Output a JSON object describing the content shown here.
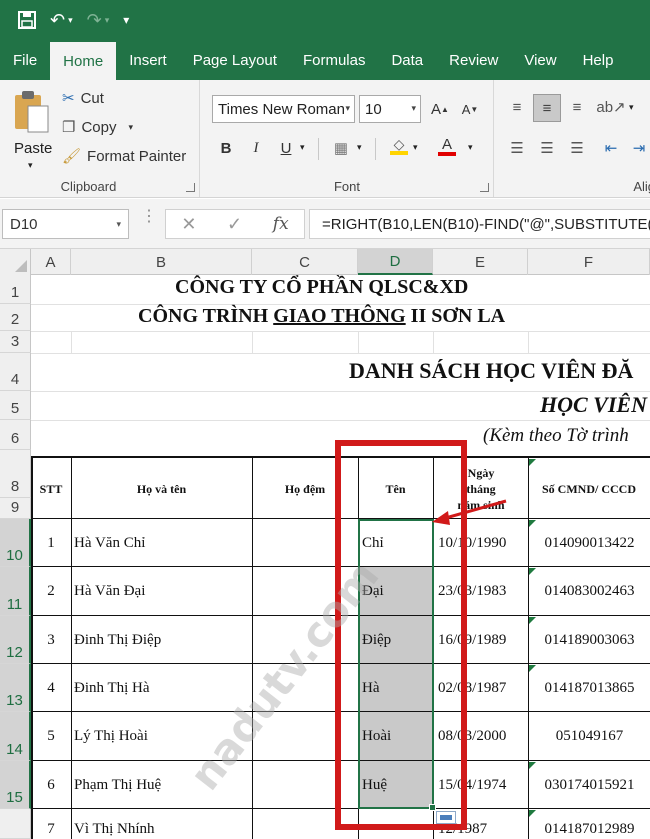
{
  "qat": {
    "save": "save-icon",
    "undo": "undo-icon",
    "redo": "redo-icon",
    "customize": "customize-icon"
  },
  "tabs": [
    "File",
    "Home",
    "Insert",
    "Page Layout",
    "Formulas",
    "Data",
    "Review",
    "View",
    "Help"
  ],
  "active_tab": "Home",
  "clipboard": {
    "paste": "Paste",
    "cut": "Cut",
    "copy": "Copy",
    "format_painter": "Format Painter",
    "label": "Clipboard"
  },
  "font": {
    "name": "Times New Roman",
    "size": "10",
    "bold": "B",
    "italic": "I",
    "underline": "U",
    "label": "Font",
    "font_color": "#e00000",
    "fill_color": "#ffd400"
  },
  "alignment": {
    "label": "Alig"
  },
  "formula_bar": {
    "name_box": "D10",
    "formula": "=RIGHT(B10,LEN(B10)-FIND(\"@\",SUBSTITUTE(B"
  },
  "columns": [
    "A",
    "B",
    "C",
    "D",
    "E",
    "F"
  ],
  "rows": [
    "1",
    "2",
    "3",
    "4",
    "5",
    "6",
    "8",
    "9",
    "10",
    "11",
    "12",
    "13",
    "14",
    "15"
  ],
  "sheet": {
    "title_line1": "CÔNG TY CỔ PHẦN QLSC&XD",
    "title_line2_pre": "CÔNG TRÌNH ",
    "title_line2_ul": "GIAO THÔNG",
    "title_line2_post": " II SƠN LA",
    "list_title": "DANH SÁCH HỌC VIÊN ĐĂ",
    "sub_title": "HỌC VIÊN",
    "note": "(Kèm theo Tờ trình",
    "headers": {
      "stt": "STT",
      "ho_ten": "Họ và tên",
      "ho_dem": "Họ đệm",
      "ten": "Tên",
      "ngay_sinh": "Ngày tháng năm sinh",
      "cmnd": "Số CMND/ CCCD"
    },
    "records": [
      {
        "stt": "1",
        "name": "Hà Văn Chỉ",
        "ten": "Chỉ",
        "dob": "10/10/1990",
        "id": "014090013422"
      },
      {
        "stt": "2",
        "name": "Hà Văn Đại",
        "ten": "Đại",
        "dob": "23/03/1983",
        "id": "014083002463"
      },
      {
        "stt": "3",
        "name": "Đinh Thị Điệp",
        "ten": "Điệp",
        "dob": "16/09/1989",
        "id": "014189003063"
      },
      {
        "stt": "4",
        "name": "Đinh Thị Hà",
        "ten": "Hà",
        "dob": "02/08/1987",
        "id": "014187013865"
      },
      {
        "stt": "5",
        "name": "Lý Thị Hoài",
        "ten": "Hoài",
        "dob": "08/03/2000",
        "id": "051049167"
      },
      {
        "stt": "6",
        "name": "Phạm Thị Huệ",
        "ten": "Huệ",
        "dob": "15/04/1974",
        "id": "030174015921"
      },
      {
        "stt": "7",
        "name": "Vì Thị Nhính",
        "ten": "",
        "dob": "12/1987",
        "id": "014187012989"
      }
    ]
  },
  "watermark": "nadutv.com",
  "annotation_color": "#d11a1a"
}
